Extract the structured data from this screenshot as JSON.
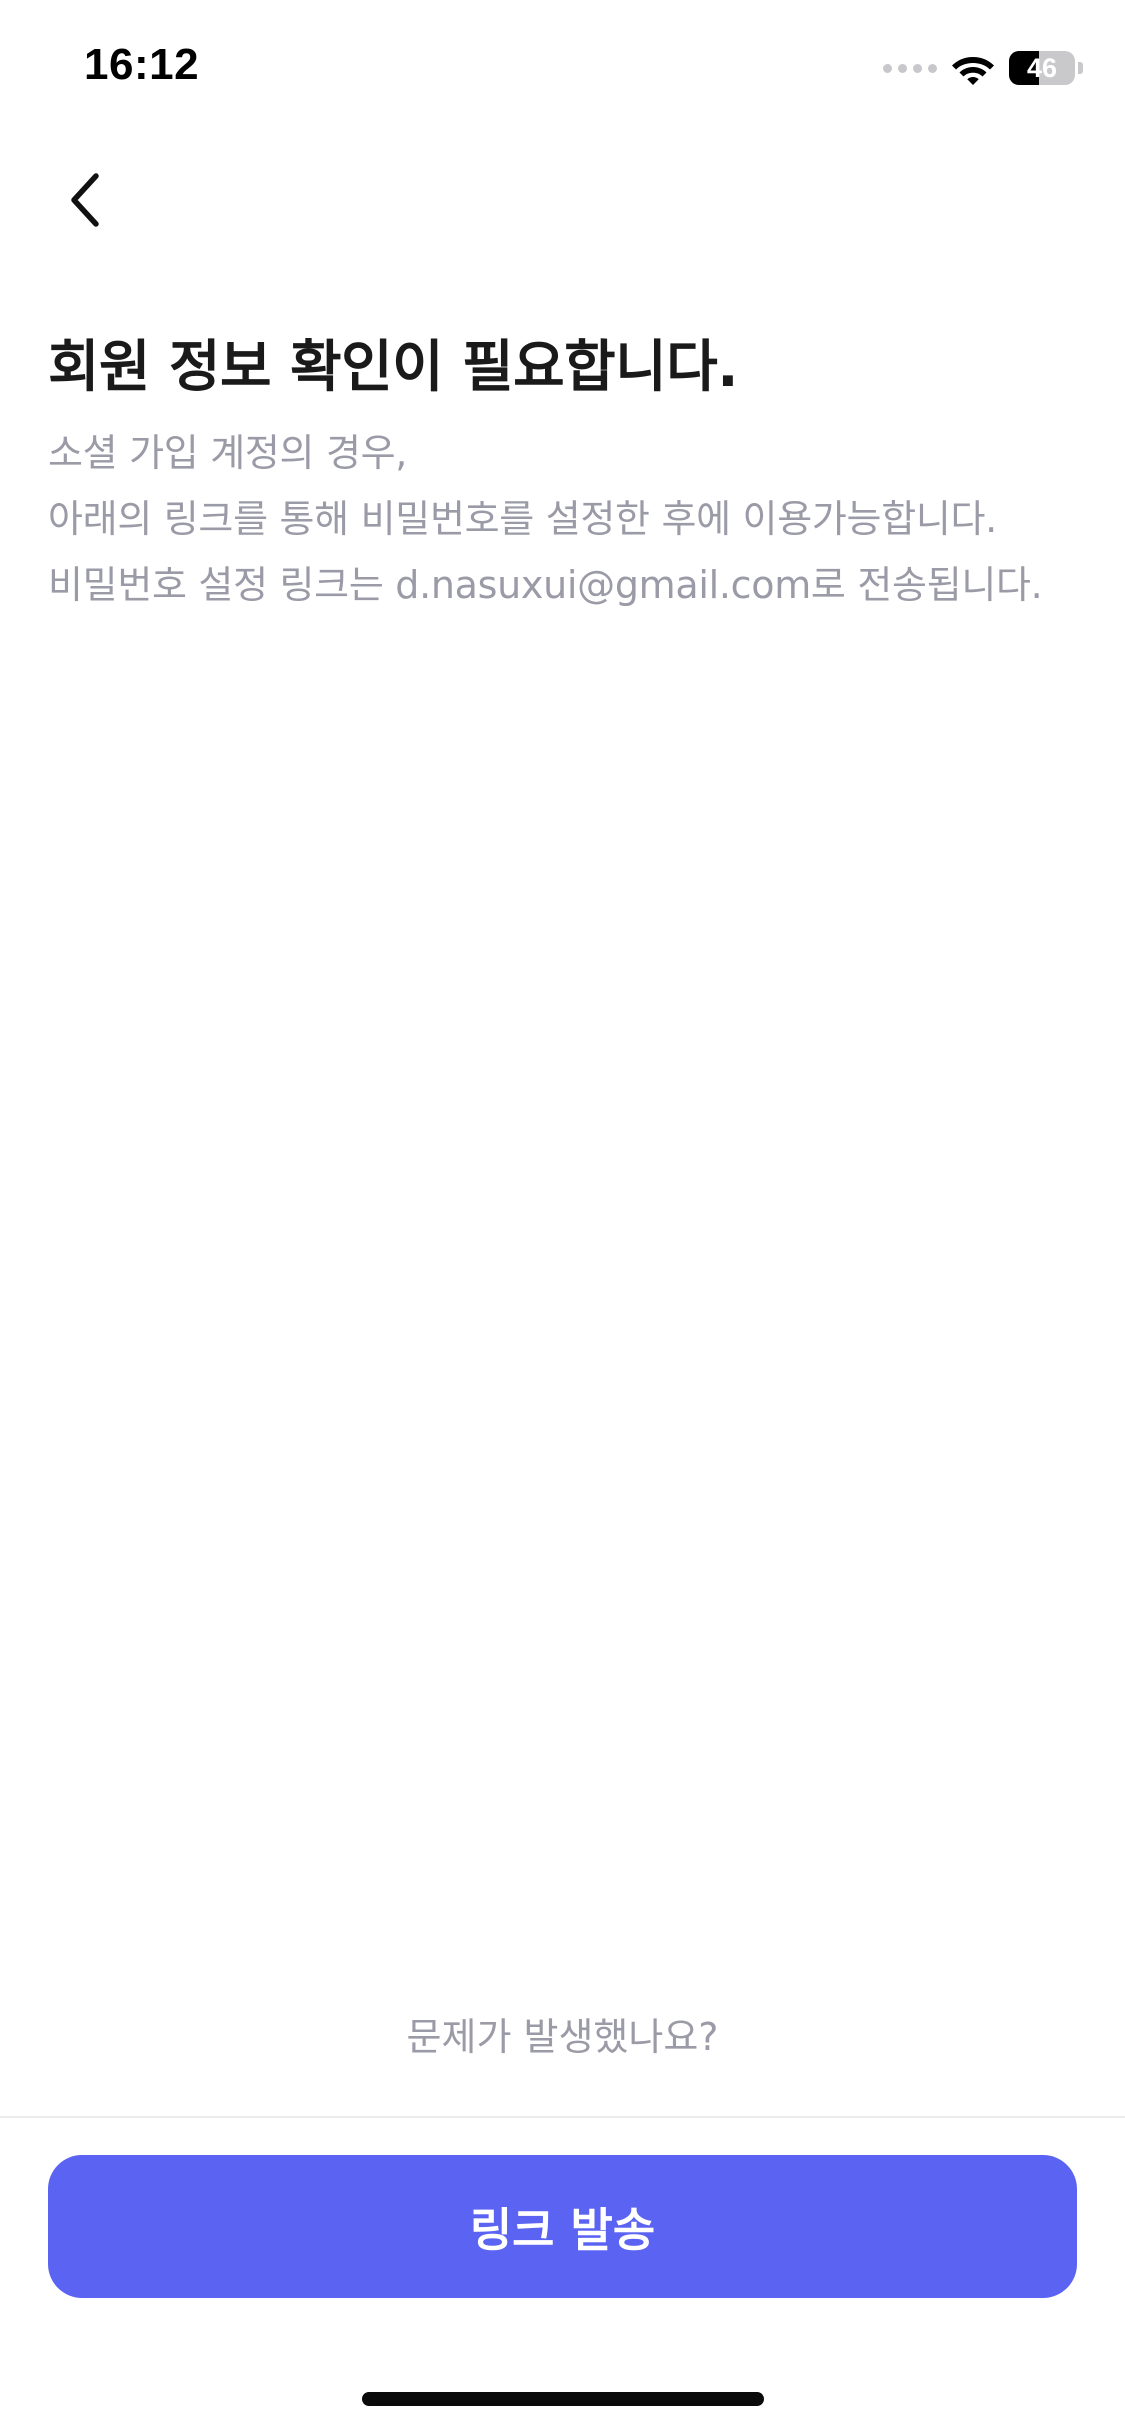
{
  "status_bar": {
    "time": "16:12",
    "battery_level": "46",
    "battery_fraction": 0.46,
    "icons": [
      "signal-dots-icon",
      "wifi-icon",
      "battery-icon"
    ]
  },
  "navigation": {
    "back_icon": "chevron-left-icon"
  },
  "content": {
    "title": "회원 정보 확인이 필요합니다.",
    "description_lines": [
      "소셜 가입 계정의 경우,",
      "아래의 링크를 통해 비밀번호를 설정한 후에 이용가능합니다.",
      "비밀번호 설정 링크는 d.nasuxui@gmail.com로 전송됩니다."
    ]
  },
  "footer": {
    "help_link": "문제가 발생했나요?",
    "primary_button": "링크 발송"
  },
  "colors": {
    "accent": "#5B63F2",
    "muted_text": "#9A9BA6",
    "title_text": "#1A1A1A"
  }
}
